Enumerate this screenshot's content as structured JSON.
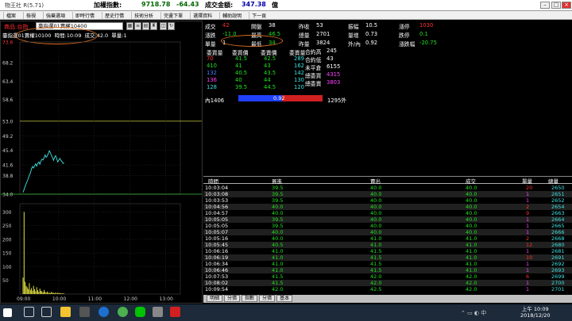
{
  "titlebar": {
    "app": "物王社 R(5.71)",
    "index_label": "加權指數:",
    "index_value": "9718.78",
    "index_change": "-64.43",
    "amount_label": "成交金額:",
    "amount_value": "347.38",
    "amount_unit": "億"
  },
  "menu": [
    "檔案",
    "檢視",
    "強棄選項",
    "即時行情",
    "歷史行情",
    "技術分析",
    "完畫下單",
    "選擇資料",
    "輔助說明",
    "下一頁"
  ],
  "left": {
    "product_label": "商品:台指",
    "product_select": "臺指選01賣權10400",
    "info": {
      "name": "臺指選01賣權10100",
      "time": "時間:10:09",
      "price": "成交:42.0",
      "volume": "單量:1"
    },
    "chart_data": {
      "type": "line",
      "y_price_ticks": [
        "73.6",
        "68.2",
        "63.4",
        "58.6",
        "53.0",
        "49.2",
        "45.4",
        "41.6",
        "38.8",
        "34.0"
      ],
      "ref_high": "53.0",
      "ref_low": "34.0",
      "y_vol_ticks": [
        "300",
        "250",
        "200",
        "150",
        "100",
        "50"
      ],
      "x_ticks": [
        "09:00",
        "10:00",
        "11:00",
        "12:00",
        "13:00"
      ],
      "price": [
        34.5,
        35.2,
        36.0,
        36.8,
        37.4,
        38.1,
        38.9,
        39.5,
        40.6,
        41.2,
        40.8,
        41.4,
        41.9,
        41.3,
        42.0,
        42.4,
        41.8,
        42.6,
        43.1,
        42.9,
        43.5,
        44.2,
        43.6,
        43.9,
        44.6,
        45.3,
        44.8,
        44.1,
        43.5,
        42.8,
        43.6,
        44.0,
        43.2,
        42.4,
        42.9,
        43.3,
        42.8,
        42.5,
        42.0,
        42.1
      ],
      "volume": [
        60,
        300,
        45,
        30,
        25,
        18,
        40,
        15,
        22,
        12,
        30,
        18,
        10,
        25,
        14,
        8,
        20,
        12,
        10,
        6,
        15,
        8,
        5,
        9,
        4,
        6,
        3,
        8,
        5,
        4,
        3,
        6,
        2,
        5,
        3,
        4,
        2,
        3,
        2,
        2
      ]
    }
  },
  "quote": {
    "row1": [
      {
        "k": "成交",
        "v": "42",
        "c": "r"
      },
      {
        "k": "開盤",
        "v": "38",
        "c": "w"
      },
      {
        "k": "昨收",
        "v": "53",
        "c": "w"
      },
      {
        "k": "振幅",
        "v": "10.5",
        "c": "w"
      },
      {
        "k": "漲停",
        "v": "1030",
        "c": "r"
      }
    ],
    "row2": [
      {
        "k": "漲跌",
        "v": "-11.0",
        "c": "g"
      },
      {
        "k": "最高",
        "v": "46.5",
        "c": "g"
      },
      {
        "k": "總量",
        "v": "2701",
        "c": "w"
      },
      {
        "k": "量增",
        "v": "0.73",
        "c": "w"
      },
      {
        "k": "跌停",
        "v": "0.1",
        "c": "g"
      }
    ],
    "row3": [
      {
        "k": "單量",
        "v": "1",
        "c": "w"
      },
      {
        "k": "最低",
        "v": "34",
        "c": "g"
      },
      {
        "k": "昨量",
        "v": "3824",
        "c": "w"
      },
      {
        "k": "外/內",
        "v": "0.92",
        "c": "w"
      },
      {
        "k": "漲跌幅",
        "v": "-20.75",
        "c": "g"
      }
    ],
    "book_headers": [
      "委買量",
      "委買價",
      "委賣價",
      "委賣量"
    ],
    "book": [
      {
        "bq": "70",
        "bp": "41.5",
        "ap": "42.5",
        "aq": "289"
      },
      {
        "bq": "410",
        "bp": "41",
        "ap": "43",
        "aq": "162"
      },
      {
        "bq": "132",
        "bp": "40.5",
        "ap": "43.5",
        "aq": "142"
      },
      {
        "bq": "136",
        "bp": "40",
        "ap": "44",
        "aq": "130"
      },
      {
        "bq": "128",
        "bp": "39.5",
        "ap": "44.5",
        "aq": "120"
      }
    ],
    "stats": [
      {
        "k": "合約高",
        "v": "245",
        "c": "w"
      },
      {
        "k": "合約低",
        "v": "43",
        "c": "w"
      },
      {
        "k": "未平倉",
        "v": "6155",
        "c": "w"
      },
      {
        "k": "總委買",
        "v": "4315",
        "c": "m"
      },
      {
        "k": "總委賣",
        "v": "3803",
        "c": "m"
      }
    ],
    "inner": "內1406",
    "ratio": "0.92",
    "outer": "1295外",
    "ratio_fraction": 0.52
  },
  "trades": {
    "headers": [
      "時間",
      "買進",
      "賣出",
      "成交",
      "單量",
      "總量"
    ],
    "rows": [
      [
        "10:03:04",
        "39.5",
        "40.0",
        "40.0",
        "20",
        "2650"
      ],
      [
        "10:03:08",
        "39.5",
        "40.0",
        "40.0",
        "1",
        "2651"
      ],
      [
        "10:03:53",
        "39.5",
        "40.0",
        "40.0",
        "1",
        "2652"
      ],
      [
        "10:04:56",
        "40.0",
        "40.0",
        "40.0",
        "2",
        "2654"
      ],
      [
        "10:04:57",
        "40.0",
        "40.0",
        "40.0",
        "9",
        "2663"
      ],
      [
        "10:05:05",
        "39.5",
        "40.0",
        "40.0",
        "1",
        "2664"
      ],
      [
        "10:05:05",
        "39.5",
        "40.0",
        "40.0",
        "1",
        "2665"
      ],
      [
        "10:05:07",
        "40.0",
        "40.0",
        "40.0",
        "1",
        "2666"
      ],
      [
        "10:05:16",
        "40.0",
        "41.0",
        "41.0",
        "2",
        "2668"
      ],
      [
        "10:05:45",
        "40.5",
        "41.0",
        "41.0",
        "12",
        "2680"
      ],
      [
        "10:06:16",
        "41.0",
        "41.5",
        "41.0",
        "1",
        "2681"
      ],
      [
        "10:06:19",
        "41.0",
        "41.5",
        "41.0",
        "10",
        "2691"
      ],
      [
        "10:06:34",
        "41.0",
        "41.5",
        "41.0",
        "1",
        "2692"
      ],
      [
        "10:06:46",
        "41.0",
        "41.5",
        "41.0",
        "1",
        "2693"
      ],
      [
        "10:07:53",
        "41.5",
        "42.0",
        "42.0",
        "6",
        "2699"
      ],
      [
        "10:08:02",
        "41.5",
        "42.0",
        "42.0",
        "1",
        "2700"
      ],
      [
        "10:09:54",
        "42.0",
        "42.5",
        "42.0",
        "1",
        "2701"
      ]
    ]
  },
  "tabs": [
    "明細",
    "分價",
    "指數",
    "分價",
    "基本"
  ],
  "taskbar": {
    "time": "上午 10:09",
    "date": "2018/12/20",
    "ime": "中"
  }
}
